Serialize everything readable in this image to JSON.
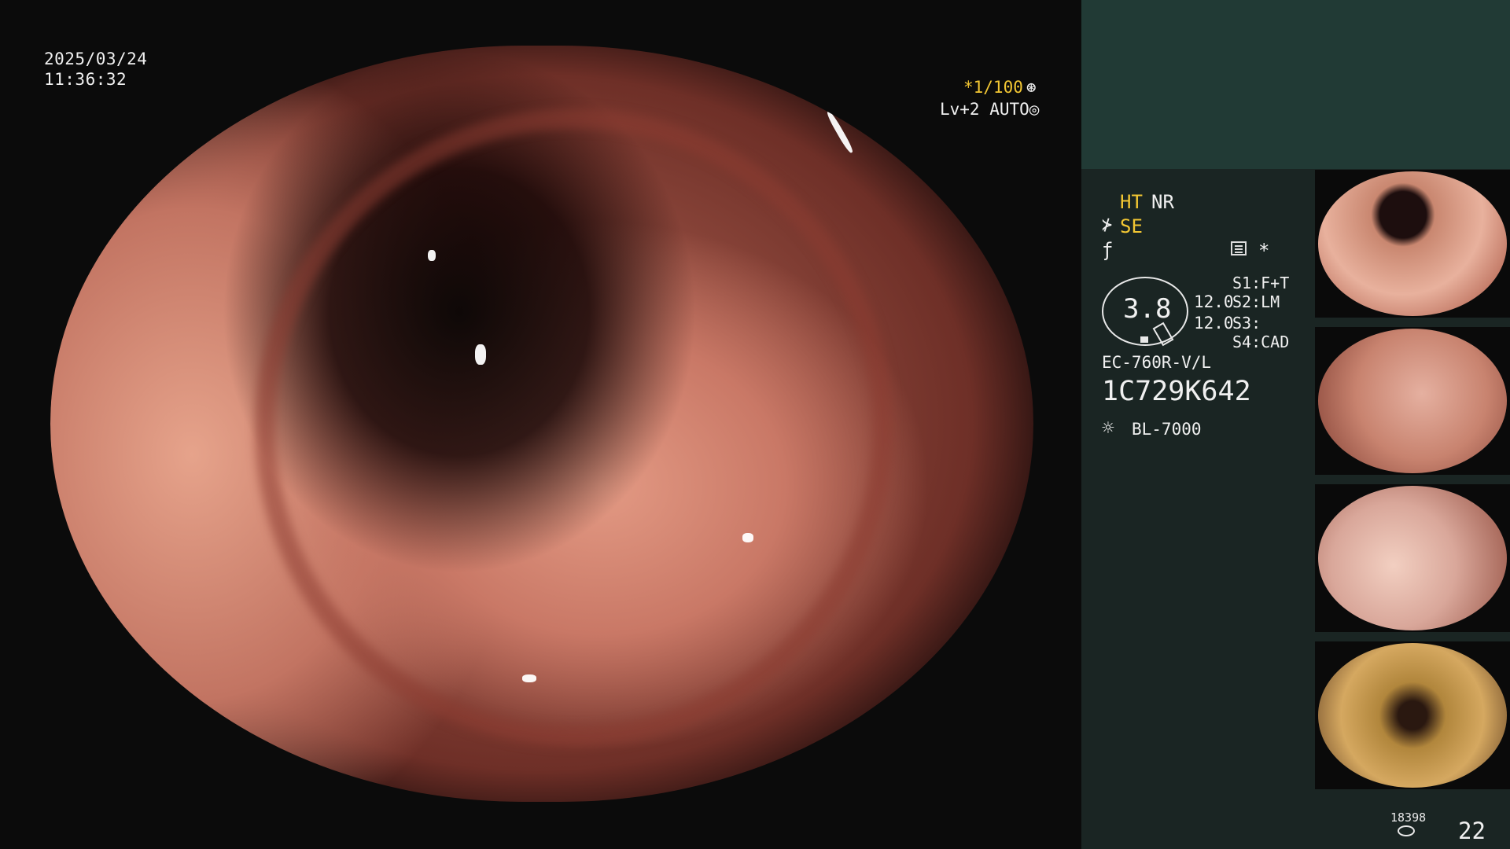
{
  "overlay": {
    "date": "2025/03/24",
    "time": "11:36:32",
    "shutter": "*1/100",
    "shutter_icon": "⊛",
    "level": "Lv+2 AUTO",
    "level_icon": "◎"
  },
  "panel": {
    "ht": "HT",
    "nr": "NR",
    "se_icon": "⊁",
    "se": "SE",
    "f_icon": "ƒ",
    "star": "*",
    "zoom_value": "3.8",
    "value1": "12.0",
    "value2": "12.0",
    "switches": [
      "S1:F+T",
      "S2:LM",
      "S3:",
      "S4:CAD"
    ],
    "model": "EC-760R-V/L",
    "serial": "1C729K642",
    "light_icon": "☼",
    "light_source": "BL-7000",
    "counter_small": "18398",
    "counter_big": "22",
    "colors": {
      "panel_bg": "#1a2523",
      "panel_top": "#213a35",
      "accent": "#f3c733"
    }
  }
}
